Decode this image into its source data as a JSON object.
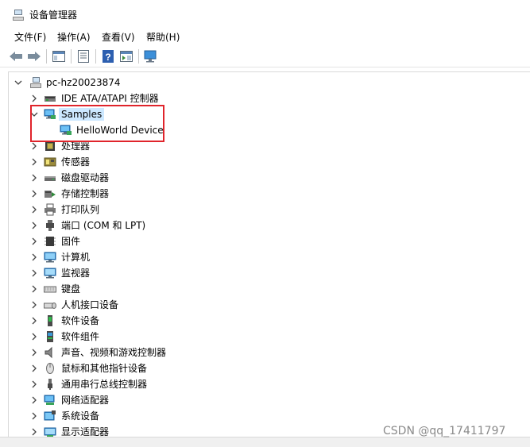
{
  "window": {
    "title": "设备管理器"
  },
  "menu": {
    "items": [
      "文件(F)",
      "操作(A)",
      "查看(V)",
      "帮助(H)"
    ]
  },
  "toolbar": {
    "icons": [
      "back-arrow-icon",
      "forward-arrow-icon",
      "show-hide-tree-icon",
      "properties-icon",
      "help-icon",
      "action-pane-icon",
      "scan-hardware-icon"
    ]
  },
  "tree": {
    "root": "pc-hz20023874",
    "items": [
      {
        "label": "IDE ATA/ATAPI 控制器",
        "icon": "ide-controller-icon"
      },
      {
        "label": "Samples",
        "icon": "network-monitor-icon",
        "expanded": true,
        "selected": true
      },
      {
        "label": "HelloWorld Device",
        "icon": "network-monitor-icon",
        "child": true
      },
      {
        "label": "处理器",
        "icon": "processor-icon"
      },
      {
        "label": "传感器",
        "icon": "sensor-icon"
      },
      {
        "label": "磁盘驱动器",
        "icon": "disk-drive-icon"
      },
      {
        "label": "存储控制器",
        "icon": "storage-controller-icon"
      },
      {
        "label": "打印队列",
        "icon": "printer-icon"
      },
      {
        "label": "端口 (COM 和 LPT)",
        "icon": "port-icon"
      },
      {
        "label": "固件",
        "icon": "firmware-icon"
      },
      {
        "label": "计算机",
        "icon": "computer-icon"
      },
      {
        "label": "监视器",
        "icon": "monitor-icon"
      },
      {
        "label": "键盘",
        "icon": "keyboard-icon"
      },
      {
        "label": "人机接口设备",
        "icon": "hid-icon"
      },
      {
        "label": "软件设备",
        "icon": "software-device-icon"
      },
      {
        "label": "软件组件",
        "icon": "software-component-icon"
      },
      {
        "label": "声音、视频和游戏控制器",
        "icon": "speaker-icon"
      },
      {
        "label": "鼠标和其他指针设备",
        "icon": "mouse-icon"
      },
      {
        "label": "通用串行总线控制器",
        "icon": "usb-icon"
      },
      {
        "label": "网络适配器",
        "icon": "network-adapter-icon"
      },
      {
        "label": "系统设备",
        "icon": "system-device-icon"
      },
      {
        "label": "显示适配器",
        "icon": "display-adapter-icon"
      }
    ]
  },
  "watermark": "CSDN @qq_17411797",
  "colors": {
    "selection": "#cce8ff",
    "highlight_box": "#e0242b",
    "network_icon": "#2e8bd6"
  }
}
